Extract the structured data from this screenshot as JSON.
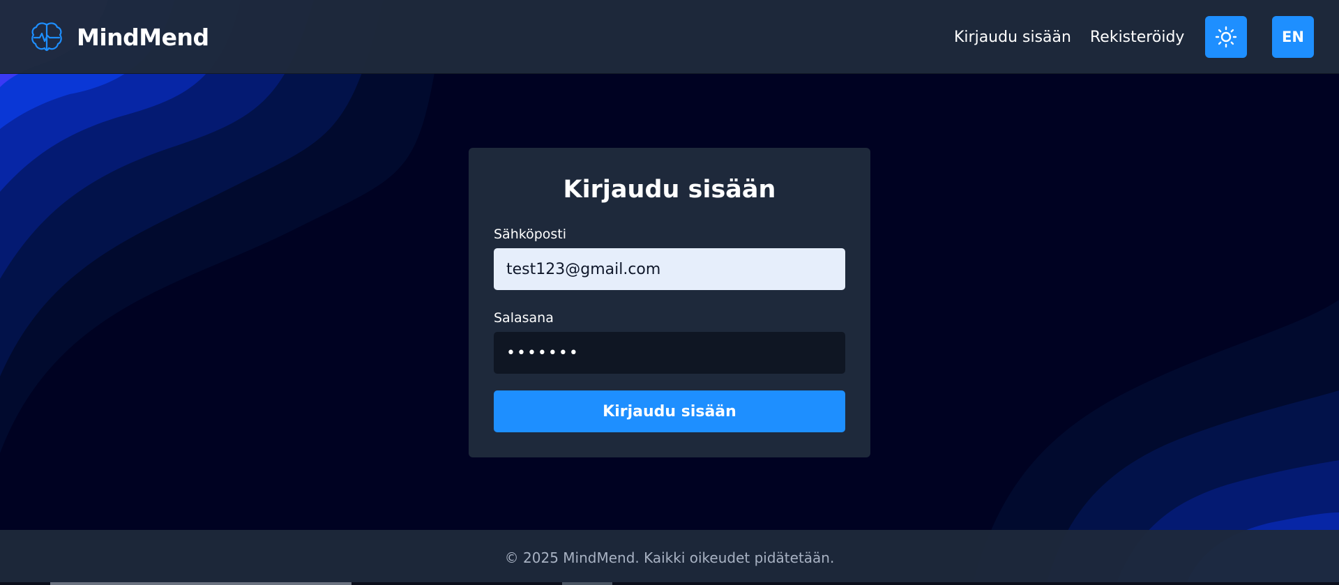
{
  "app": {
    "brand_name": "MindMend",
    "brand_icon": "brain-pulse-icon"
  },
  "header": {
    "nav": {
      "login_label": "Kirjaudu sisään",
      "register_label": "Rekisteröidy"
    },
    "theme_toggle_icon": "sun-icon",
    "language_label": "EN"
  },
  "login_form": {
    "title": "Kirjaudu sisään",
    "email_label": "Sähköposti",
    "email_value": "test123@gmail.com",
    "password_label": "Salasana",
    "password_value": "•••••••",
    "submit_label": "Kirjaudu sisään"
  },
  "footer": {
    "text": "© 2025 MindMend. Kaikki oikeudet pidätetään."
  },
  "colors": {
    "background": "#000222",
    "header_bg": "#1e293b",
    "card_bg": "#1e293b",
    "accent": "#1e8fff",
    "email_input_bg": "#e6eefb",
    "password_input_bg": "#0f1623",
    "footer_text": "#a8b2c3",
    "wave_colors": [
      "#3a3af5",
      "#0a37d6",
      "#0726a6",
      "#041a72",
      "#02124a",
      "#010a2e"
    ]
  }
}
